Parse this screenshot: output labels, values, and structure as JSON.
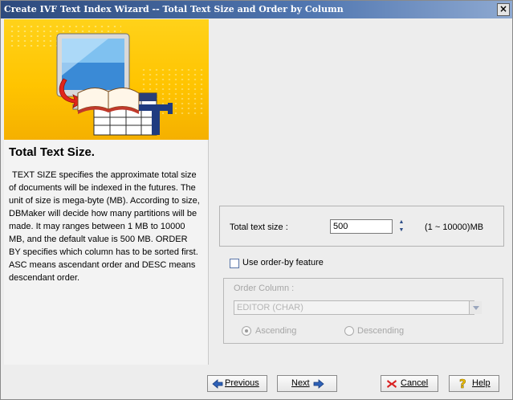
{
  "window": {
    "title": "Create IVF Text Index Wizard -- Total Text Size and Order by Column",
    "close_glyph": "×"
  },
  "left": {
    "title": "Total Text Size.",
    "description": "TEXT SIZE specifies the approximate total size of documents will be indexed in the futures. The unit of size is mega-byte (MB). According to size, DBMaker will decide how many partitions will be made. It may ranges between 1 MB to 10000 MB, and the default value is 500 MB. ORDER BY specifies which column has to be sorted first. ASC means ascendant order and DESC means descendant order.",
    "banner_icon": "monitor-book-table-icon"
  },
  "size": {
    "label": "Total text size :",
    "value": "500",
    "range": "(1 ~ 10000)MB"
  },
  "orderby": {
    "checkbox_label": "Use order-by feature",
    "checked": false,
    "group_title": "Order Column :",
    "column_value": "EDITOR (CHAR)",
    "ascending_label": "Ascending",
    "descending_label": "Descending",
    "selected": "Ascending"
  },
  "buttons": {
    "previous": "Previous",
    "next": "Next",
    "cancel": "Cancel",
    "help": "Help"
  },
  "colors": {
    "title_bar": "#2d4a7d",
    "banner": "#ffc400",
    "disabled_text": "#a6a6a6",
    "arrow_blue": "#2f62b8",
    "cancel_red": "#d92020",
    "help_yellow": "#f2c200"
  }
}
